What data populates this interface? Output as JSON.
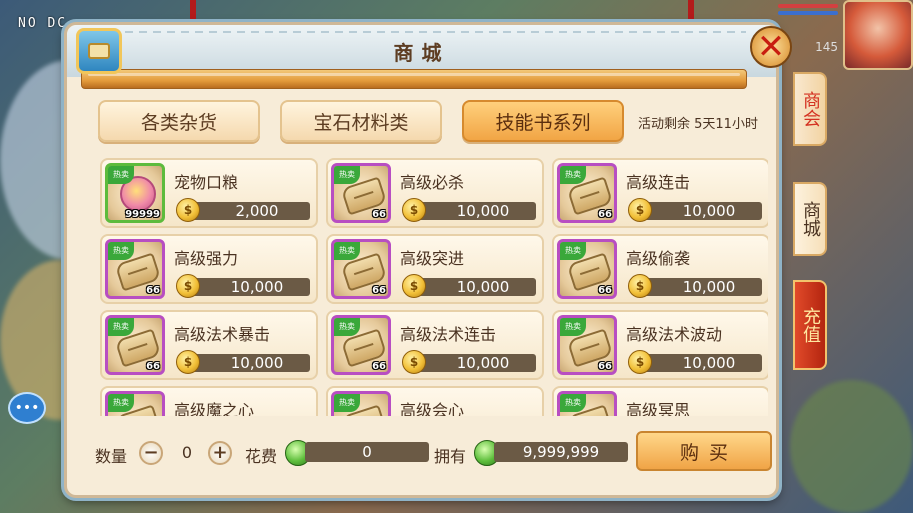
{
  "debug_overlay": "NO DC",
  "hud": {
    "level_text": "145"
  },
  "window": {
    "title": "商城",
    "close_label": "✕"
  },
  "tabs": [
    {
      "label": "各类杂货",
      "active": false
    },
    {
      "label": "宝石材料类",
      "active": false
    },
    {
      "label": "技能书系列",
      "active": true
    }
  ],
  "event_timer": "活动剩余 5天11小时",
  "hot_tag": "热卖",
  "items": [
    {
      "name": "宠物口粮",
      "price": "2,000",
      "count": "99999",
      "icon": "pet-food-icon",
      "frame": "green"
    },
    {
      "name": "高级必杀",
      "price": "10,000",
      "count": "66",
      "icon": "skill-book-icon",
      "frame": "purple"
    },
    {
      "name": "高级连击",
      "price": "10,000",
      "count": "66",
      "icon": "skill-book-icon",
      "frame": "purple"
    },
    {
      "name": "高级强力",
      "price": "10,000",
      "count": "66",
      "icon": "skill-book-icon",
      "frame": "purple"
    },
    {
      "name": "高级突进",
      "price": "10,000",
      "count": "66",
      "icon": "skill-book-icon",
      "frame": "purple"
    },
    {
      "name": "高级偷袭",
      "price": "10,000",
      "count": "66",
      "icon": "skill-book-icon",
      "frame": "purple"
    },
    {
      "name": "高级法术暴击",
      "price": "10,000",
      "count": "66",
      "icon": "skill-book-icon",
      "frame": "purple"
    },
    {
      "name": "高级法术连击",
      "price": "10,000",
      "count": "66",
      "icon": "skill-book-icon",
      "frame": "purple"
    },
    {
      "name": "高级法术波动",
      "price": "10,000",
      "count": "66",
      "icon": "skill-book-icon",
      "frame": "purple"
    },
    {
      "name": "高级魔之心",
      "price": "",
      "count": "",
      "icon": "skill-book-icon",
      "frame": "purple"
    },
    {
      "name": "高级会心",
      "price": "",
      "count": "",
      "icon": "skill-book-icon",
      "frame": "purple"
    },
    {
      "name": "高级冥思",
      "price": "",
      "count": "",
      "icon": "skill-book-icon",
      "frame": "purple"
    }
  ],
  "purchase": {
    "quantity_label": "数量",
    "quantity_value": "0",
    "minus": "−",
    "plus": "+",
    "cost_label": "花费",
    "cost_value": "0",
    "owned_label": "拥有",
    "owned_value": "9,999,999",
    "buy_label": "购买"
  },
  "side_tabs": [
    {
      "label": "商会",
      "style": "shop"
    },
    {
      "label": "商城",
      "style": "mall"
    },
    {
      "label": "充值",
      "style": "recharge"
    }
  ]
}
